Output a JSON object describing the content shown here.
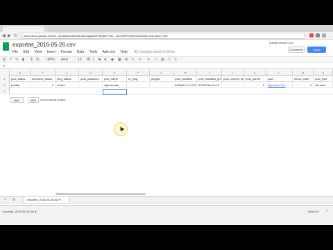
{
  "browser": {
    "url": "https://docs.google.com/a/.../spreadsheets/d/1Jbd1ag43kDiP4xD6iCPt4b...ZZCb3PEKIhbD9y4ja/edit?usp=drive_web",
    "back_label": "◀",
    "fwd_label": "▶",
    "reload_label": "↻"
  },
  "app": {
    "title": "exportas_2016-05-26.csv",
    "file_ext_badge": "☆",
    "user_email": "mail@example.com",
    "menu": [
      "File",
      "Edit",
      "View",
      "Insert",
      "Format",
      "Data",
      "Tools",
      "Add-ons",
      "Help"
    ],
    "save_status": "All changes saved in Drive",
    "comments_label": "Comments",
    "share_label": "Share"
  },
  "toolbar": {
    "zoom": "100%",
    "font": "Arial",
    "font_size": "10",
    "fx_label": "fx"
  },
  "grid": {
    "columns": [
      "A",
      "B",
      "C",
      "D",
      "E",
      "F",
      "G",
      "H",
      "I",
      "J",
      "K",
      "L",
      "M",
      "N"
    ],
    "rows": [
      {
        "num": "1",
        "cells": [
          "post_status",
          "comment_status",
          "ping_status",
          "post_password",
          "post_name",
          "to_ping",
          "pinged",
          "post_modified",
          "post_modified_gmt",
          "post_content_filtered",
          "post_parent",
          "guid",
          "menu_order",
          "post_type"
        ]
      },
      {
        "num": "2",
        "cells": [
          "publish",
          "0",
          "closed",
          "",
          "raja-ahmad",
          "",
          "",
          "5/26/2016 0:14:5",
          "5/26/2016 0:14:5",
          "",
          "0",
          "http://mo.i/?p=",
          "0",
          "vit-result"
        ]
      },
      {
        "num": "3",
        "cells": [
          "",
          "",
          "",
          "",
          "",
          "",
          "",
          "",
          "",
          "",
          "",
          "",
          "",
          ""
        ]
      }
    ]
  },
  "add_rows": {
    "button_label": "Add",
    "count": "1000",
    "suffix": "more rows at bottom."
  },
  "sheets": {
    "add_icon": "+",
    "list_icon": "≡",
    "active_tab": "exportas_2016-05-26.csv ▾"
  },
  "downloads": {
    "item": "exportas_2016-05-26.csv ▾",
    "show_all": "Show All",
    "close": "×"
  }
}
